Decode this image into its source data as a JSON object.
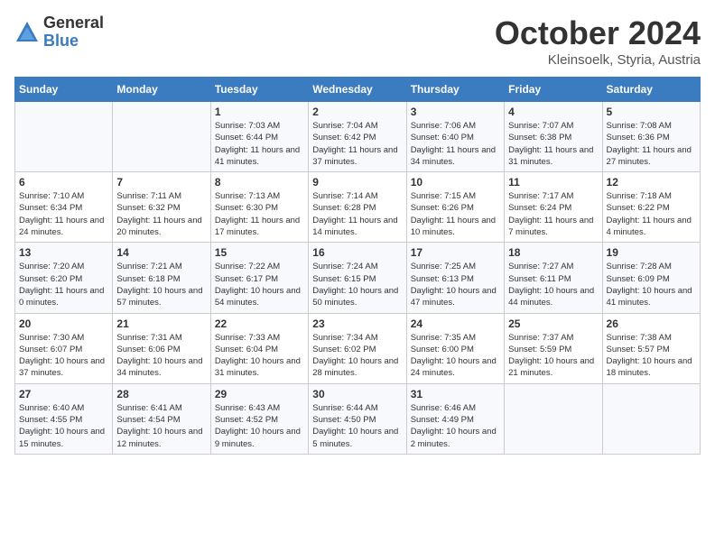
{
  "logo": {
    "general": "General",
    "blue": "Blue"
  },
  "title": "October 2024",
  "subtitle": "Kleinsoelk, Styria, Austria",
  "days_of_week": [
    "Sunday",
    "Monday",
    "Tuesday",
    "Wednesday",
    "Thursday",
    "Friday",
    "Saturday"
  ],
  "weeks": [
    [
      {
        "day": "",
        "info": ""
      },
      {
        "day": "",
        "info": ""
      },
      {
        "day": "1",
        "info": "Sunrise: 7:03 AM\nSunset: 6:44 PM\nDaylight: 11 hours and 41 minutes."
      },
      {
        "day": "2",
        "info": "Sunrise: 7:04 AM\nSunset: 6:42 PM\nDaylight: 11 hours and 37 minutes."
      },
      {
        "day": "3",
        "info": "Sunrise: 7:06 AM\nSunset: 6:40 PM\nDaylight: 11 hours and 34 minutes."
      },
      {
        "day": "4",
        "info": "Sunrise: 7:07 AM\nSunset: 6:38 PM\nDaylight: 11 hours and 31 minutes."
      },
      {
        "day": "5",
        "info": "Sunrise: 7:08 AM\nSunset: 6:36 PM\nDaylight: 11 hours and 27 minutes."
      }
    ],
    [
      {
        "day": "6",
        "info": "Sunrise: 7:10 AM\nSunset: 6:34 PM\nDaylight: 11 hours and 24 minutes."
      },
      {
        "day": "7",
        "info": "Sunrise: 7:11 AM\nSunset: 6:32 PM\nDaylight: 11 hours and 20 minutes."
      },
      {
        "day": "8",
        "info": "Sunrise: 7:13 AM\nSunset: 6:30 PM\nDaylight: 11 hours and 17 minutes."
      },
      {
        "day": "9",
        "info": "Sunrise: 7:14 AM\nSunset: 6:28 PM\nDaylight: 11 hours and 14 minutes."
      },
      {
        "day": "10",
        "info": "Sunrise: 7:15 AM\nSunset: 6:26 PM\nDaylight: 11 hours and 10 minutes."
      },
      {
        "day": "11",
        "info": "Sunrise: 7:17 AM\nSunset: 6:24 PM\nDaylight: 11 hours and 7 minutes."
      },
      {
        "day": "12",
        "info": "Sunrise: 7:18 AM\nSunset: 6:22 PM\nDaylight: 11 hours and 4 minutes."
      }
    ],
    [
      {
        "day": "13",
        "info": "Sunrise: 7:20 AM\nSunset: 6:20 PM\nDaylight: 11 hours and 0 minutes."
      },
      {
        "day": "14",
        "info": "Sunrise: 7:21 AM\nSunset: 6:18 PM\nDaylight: 10 hours and 57 minutes."
      },
      {
        "day": "15",
        "info": "Sunrise: 7:22 AM\nSunset: 6:17 PM\nDaylight: 10 hours and 54 minutes."
      },
      {
        "day": "16",
        "info": "Sunrise: 7:24 AM\nSunset: 6:15 PM\nDaylight: 10 hours and 50 minutes."
      },
      {
        "day": "17",
        "info": "Sunrise: 7:25 AM\nSunset: 6:13 PM\nDaylight: 10 hours and 47 minutes."
      },
      {
        "day": "18",
        "info": "Sunrise: 7:27 AM\nSunset: 6:11 PM\nDaylight: 10 hours and 44 minutes."
      },
      {
        "day": "19",
        "info": "Sunrise: 7:28 AM\nSunset: 6:09 PM\nDaylight: 10 hours and 41 minutes."
      }
    ],
    [
      {
        "day": "20",
        "info": "Sunrise: 7:30 AM\nSunset: 6:07 PM\nDaylight: 10 hours and 37 minutes."
      },
      {
        "day": "21",
        "info": "Sunrise: 7:31 AM\nSunset: 6:06 PM\nDaylight: 10 hours and 34 minutes."
      },
      {
        "day": "22",
        "info": "Sunrise: 7:33 AM\nSunset: 6:04 PM\nDaylight: 10 hours and 31 minutes."
      },
      {
        "day": "23",
        "info": "Sunrise: 7:34 AM\nSunset: 6:02 PM\nDaylight: 10 hours and 28 minutes."
      },
      {
        "day": "24",
        "info": "Sunrise: 7:35 AM\nSunset: 6:00 PM\nDaylight: 10 hours and 24 minutes."
      },
      {
        "day": "25",
        "info": "Sunrise: 7:37 AM\nSunset: 5:59 PM\nDaylight: 10 hours and 21 minutes."
      },
      {
        "day": "26",
        "info": "Sunrise: 7:38 AM\nSunset: 5:57 PM\nDaylight: 10 hours and 18 minutes."
      }
    ],
    [
      {
        "day": "27",
        "info": "Sunrise: 6:40 AM\nSunset: 4:55 PM\nDaylight: 10 hours and 15 minutes."
      },
      {
        "day": "28",
        "info": "Sunrise: 6:41 AM\nSunset: 4:54 PM\nDaylight: 10 hours and 12 minutes."
      },
      {
        "day": "29",
        "info": "Sunrise: 6:43 AM\nSunset: 4:52 PM\nDaylight: 10 hours and 9 minutes."
      },
      {
        "day": "30",
        "info": "Sunrise: 6:44 AM\nSunset: 4:50 PM\nDaylight: 10 hours and 5 minutes."
      },
      {
        "day": "31",
        "info": "Sunrise: 6:46 AM\nSunset: 4:49 PM\nDaylight: 10 hours and 2 minutes."
      },
      {
        "day": "",
        "info": ""
      },
      {
        "day": "",
        "info": ""
      }
    ]
  ]
}
